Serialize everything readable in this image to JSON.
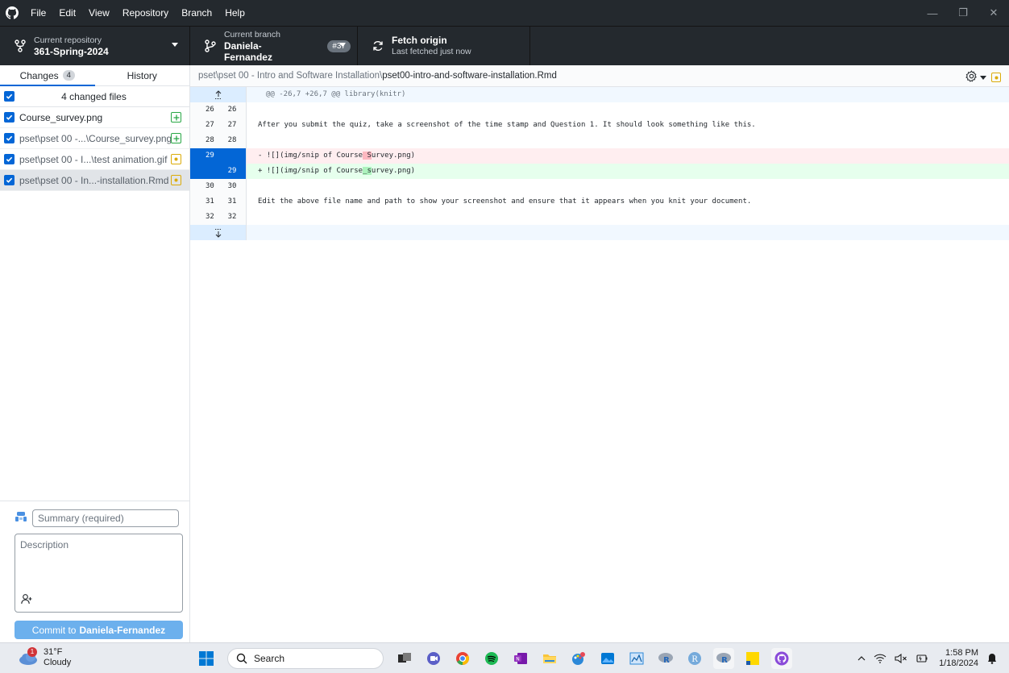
{
  "titlebar": {
    "menu": [
      "File",
      "Edit",
      "View",
      "Repository",
      "Branch",
      "Help"
    ]
  },
  "toolbar": {
    "repo_label": "Current repository",
    "repo_value": "361-Spring-2024",
    "branch_label": "Current branch",
    "branch_value": "Daniela-Fernandez",
    "branch_badge": "#37",
    "fetch_label": "Fetch origin",
    "fetch_sub": "Last fetched just now"
  },
  "sidebar": {
    "tab_changes": "Changes",
    "tab_changes_count": "4",
    "tab_history": "History",
    "all_files_label": "4 changed files",
    "files": [
      {
        "name": "Course_survey.png",
        "status": "added"
      },
      {
        "name": "pset\\pset 00 -...\\Course_survey.png",
        "status": "added"
      },
      {
        "name": "pset\\pset 00 - I...\\test animation.gif",
        "status": "modified"
      },
      {
        "name": "pset\\pset 00 - In...-installation.Rmd",
        "status": "modified"
      }
    ],
    "summary_placeholder": "Summary (required)",
    "description_placeholder": "Description",
    "commit_prefix": "Commit to",
    "commit_branch": "Daniela-Fernandez"
  },
  "diff": {
    "path_dir": "pset\\pset 00 - Intro and Software Installation\\",
    "path_file": "pset00-intro-and-software-installation.Rmd",
    "hunk_header": "@@ -26,7 +26,7 @@ library(knitr)",
    "lines": [
      {
        "old": "26",
        "new": "26",
        "text": ""
      },
      {
        "old": "27",
        "new": "27",
        "text": "After you submit the quiz, take a screenshot of the time stamp and Question 1. It should look something like this."
      },
      {
        "old": "28",
        "new": "28",
        "text": ""
      }
    ],
    "del_line": {
      "old": "29",
      "prefix": "- ![](img/snip of Course",
      "hl": " S",
      "suffix": "urvey.png)"
    },
    "add_line": {
      "new": "29",
      "prefix": "+ ![](img/snip of Course",
      "hl": "_s",
      "suffix": "urvey.png)"
    },
    "lines_after": [
      {
        "old": "30",
        "new": "30",
        "text": ""
      },
      {
        "old": "31",
        "new": "31",
        "text": "Edit the above file name and path to show your screenshot and ensure that it appears when you knit your document."
      },
      {
        "old": "32",
        "new": "32",
        "text": ""
      }
    ]
  },
  "taskbar": {
    "weather_temp": "31°F",
    "weather_desc": "Cloudy",
    "weather_badge": "1",
    "search_label": "Search",
    "time": "1:58 PM",
    "date": "1/18/2024"
  },
  "colors": {
    "accent": "#0366d6",
    "toolbar_bg": "#24292e",
    "added": "#28a745",
    "modified": "#dbab09"
  }
}
